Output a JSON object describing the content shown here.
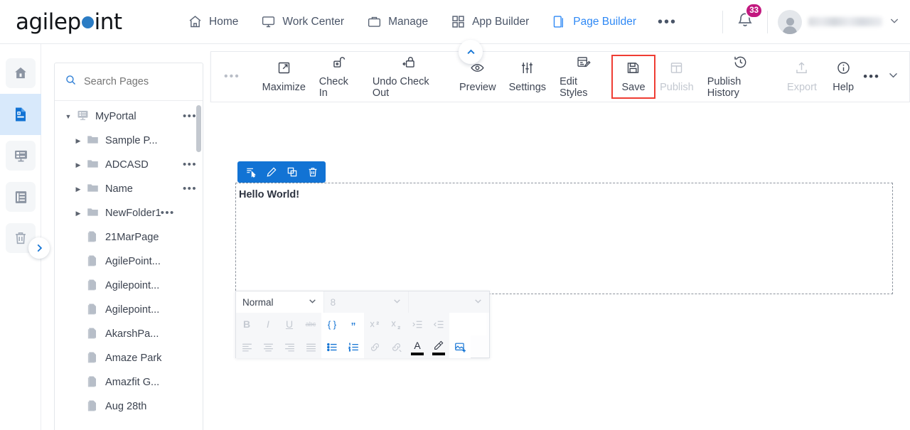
{
  "brand": {
    "name_part1": "agilep",
    "name_part2": "int",
    "dot_color": "#2b7cc4"
  },
  "topnav": {
    "items": [
      {
        "label": "Home",
        "icon": "home-icon",
        "active": false
      },
      {
        "label": "Work Center",
        "icon": "monitor-icon",
        "active": false
      },
      {
        "label": "Manage",
        "icon": "briefcase-icon",
        "active": false
      },
      {
        "label": "App Builder",
        "icon": "grid-icon",
        "active": false
      },
      {
        "label": "Page Builder",
        "icon": "pages-icon",
        "active": true
      }
    ],
    "overflow_label": "•••",
    "notification_count": "33",
    "user_chevron": "⌄"
  },
  "rail": {
    "items": [
      {
        "name": "home-icon",
        "label": "Home",
        "active": false
      },
      {
        "name": "page-icon",
        "label": "Pages",
        "active": true
      },
      {
        "name": "form-icon",
        "label": "Forms",
        "active": false
      },
      {
        "name": "list-icon",
        "label": "List",
        "active": false
      },
      {
        "name": "trash-icon",
        "label": "Recycle Bin",
        "active": false
      }
    ],
    "expand_label": "›"
  },
  "tree": {
    "search_placeholder": "Search Pages",
    "search_value": "",
    "rows": [
      {
        "caret": "▼",
        "icon": "portal-icon",
        "label": "MyPortal",
        "indent": 0,
        "dots": true
      },
      {
        "caret": "▶",
        "icon": "folder-icon",
        "label": "Sample P...",
        "indent": 1,
        "dots": false
      },
      {
        "caret": "▶",
        "icon": "folder-icon",
        "label": "ADCASD",
        "indent": 1,
        "dots": true
      },
      {
        "caret": "▶",
        "icon": "folder-icon",
        "label": "Name",
        "indent": 1,
        "dots": true
      },
      {
        "caret": "▶",
        "icon": "folder-icon",
        "label": "NewFolder1",
        "indent": 1,
        "dots": true
      },
      {
        "caret": "",
        "icon": "page-icon",
        "label": "21MarPage",
        "indent": 1,
        "dots": false
      },
      {
        "caret": "",
        "icon": "page-icon",
        "label": "AgilePoint...",
        "indent": 1,
        "dots": false
      },
      {
        "caret": "",
        "icon": "page-icon",
        "label": "Agilepoint...",
        "indent": 1,
        "dots": false
      },
      {
        "caret": "",
        "icon": "page-icon",
        "label": "Agilepoint...",
        "indent": 1,
        "dots": false
      },
      {
        "caret": "",
        "icon": "page-icon",
        "label": "AkarshPa...",
        "indent": 1,
        "dots": false
      },
      {
        "caret": "",
        "icon": "page-icon",
        "label": "Amaze Park",
        "indent": 1,
        "dots": false
      },
      {
        "caret": "",
        "icon": "page-icon",
        "label": "Amazfit G...",
        "indent": 1,
        "dots": false
      },
      {
        "caret": "",
        "icon": "page-icon",
        "label": "Aug 28th",
        "indent": 1,
        "dots": false
      }
    ]
  },
  "toolbar": {
    "lead_dots": "•••",
    "collapse_icon": "chevron-up-icon",
    "buttons": [
      {
        "label": "Maximize",
        "icon": "maximize-icon",
        "disabled": false,
        "highlight": false
      },
      {
        "label": "Check In",
        "icon": "unlock-icon",
        "disabled": false,
        "highlight": false
      },
      {
        "label": "Undo Check Out",
        "icon": "undo-checkout-icon",
        "disabled": false,
        "highlight": false
      },
      {
        "label": "Preview",
        "icon": "eye-icon",
        "disabled": false,
        "highlight": false
      },
      {
        "label": "Settings",
        "icon": "sliders-icon",
        "disabled": false,
        "highlight": false
      },
      {
        "label": "Edit Styles",
        "icon": "edit-styles-icon",
        "disabled": false,
        "highlight": false
      },
      {
        "label": "Save",
        "icon": "save-icon",
        "disabled": false,
        "highlight": true
      },
      {
        "label": "Publish",
        "icon": "publish-icon",
        "disabled": true,
        "highlight": false
      },
      {
        "label": "Publish History",
        "icon": "history-icon",
        "disabled": false,
        "highlight": false
      },
      {
        "label": "Export",
        "icon": "export-icon",
        "disabled": true,
        "highlight": false
      },
      {
        "label": "Help",
        "icon": "info-icon",
        "disabled": false,
        "highlight": false
      }
    ],
    "tail_dots": "•••",
    "tail_chevron": "chevron-down-icon"
  },
  "canvas": {
    "widget_toolbar": [
      {
        "name": "select-parent-icon"
      },
      {
        "name": "edit-pencil-icon"
      },
      {
        "name": "duplicate-icon"
      },
      {
        "name": "delete-icon"
      }
    ],
    "content_text": "Hello World!"
  },
  "rte": {
    "style_select": {
      "value": "Normal",
      "chevron": "⌄"
    },
    "size_select": {
      "value": "8",
      "chevron": "⌄"
    },
    "font_select": {
      "value": "",
      "chevron": "⌄"
    },
    "row1": [
      {
        "name": "bold-icon",
        "glyph": "B",
        "state": "dim"
      },
      {
        "name": "italic-icon",
        "glyph": "I",
        "state": "dim"
      },
      {
        "name": "underline-icon",
        "glyph": "U",
        "state": "dim"
      },
      {
        "name": "strikethrough-icon",
        "glyph": "abc",
        "state": "dim"
      },
      {
        "name": "code-block-icon",
        "glyph": "{ }",
        "state": "blue"
      },
      {
        "name": "blockquote-icon",
        "glyph": "”",
        "state": "blue"
      },
      {
        "name": "superscript-icon",
        "glyph": "X",
        "state": "dim"
      },
      {
        "name": "subscript-icon",
        "glyph": "X",
        "state": "dim"
      },
      {
        "name": "indent-icon",
        "glyph": "",
        "state": "dim"
      },
      {
        "name": "outdent-icon",
        "glyph": "",
        "state": "dim"
      }
    ],
    "row2": [
      {
        "name": "align-left-icon",
        "state": "dim"
      },
      {
        "name": "align-center-icon",
        "state": "dim"
      },
      {
        "name": "align-right-icon",
        "state": "dim"
      },
      {
        "name": "align-justify-icon",
        "state": "dim"
      },
      {
        "name": "bulleted-list-icon",
        "state": "blue"
      },
      {
        "name": "numbered-list-icon",
        "state": "blue"
      },
      {
        "name": "insert-link-icon",
        "state": "dim"
      },
      {
        "name": "unlink-icon",
        "state": "dim"
      },
      {
        "name": "text-color-icon",
        "state": "dark",
        "glyph": "A"
      },
      {
        "name": "highlight-color-icon",
        "state": "dark"
      },
      {
        "name": "insert-image-icon",
        "state": "blue"
      }
    ]
  },
  "colors": {
    "accent_blue": "#1273d4",
    "nav_active": "#2f89f5",
    "badge_magenta": "#c2187f",
    "highlight_red": "#ef3d33",
    "rail_active_bg": "#d8e9fb"
  }
}
